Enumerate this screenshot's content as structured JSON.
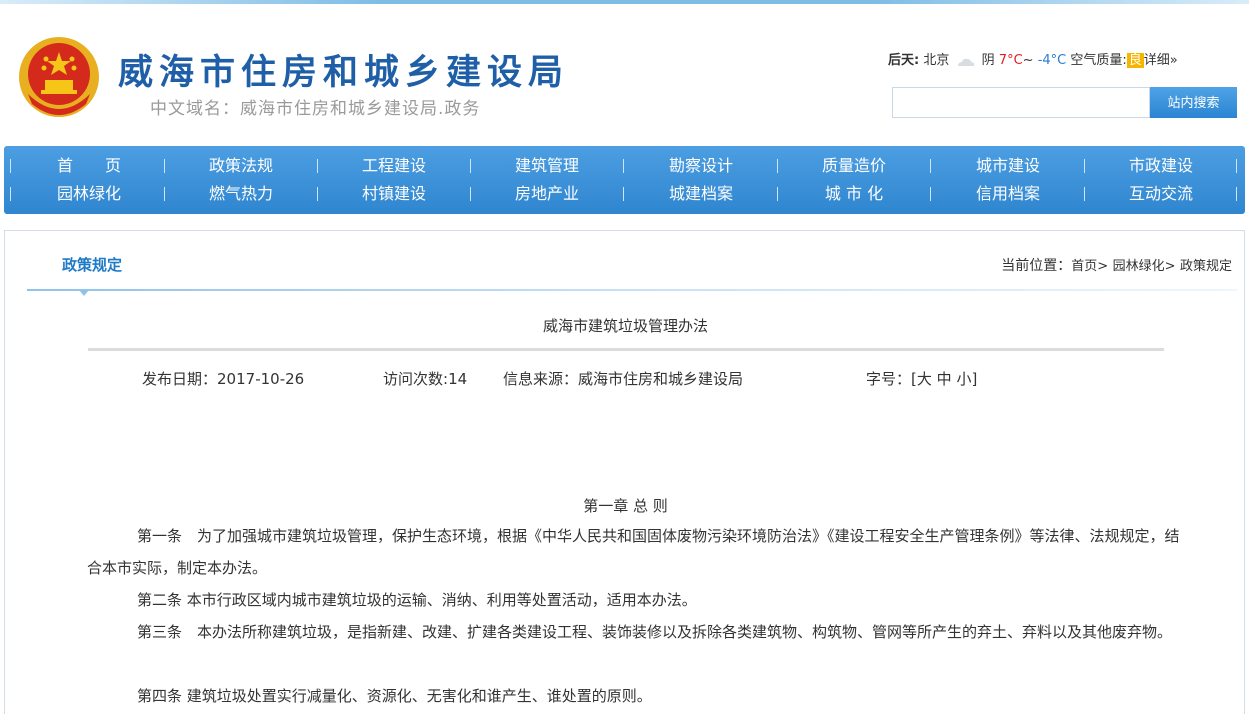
{
  "header": {
    "site_title": "威海市住房和城乡建设局",
    "site_domain": "中文域名：威海市住房和城乡建设局.政务",
    "emblem_icon": "national-emblem-icon"
  },
  "weather": {
    "day_label": "后天:",
    "city": "北京",
    "icon": "cloud-icon",
    "condition": "阴",
    "high": "7°C",
    "separator": "~",
    "low": "-4°C",
    "aqi_label": "空气质量:",
    "aqi_value": "良",
    "details_link": "详细»"
  },
  "search": {
    "placeholder": "",
    "button_label": "站内搜索"
  },
  "nav": {
    "row1": [
      "首　　页",
      "政策法规",
      "工程建设",
      "建筑管理",
      "勘察设计",
      "质量造价",
      "城市建设",
      "市政建设"
    ],
    "row2": [
      "园林绿化",
      "燃气热力",
      "村镇建设",
      "房地产业",
      "城建档案",
      "城 市 化",
      "信用档案",
      "互动交流"
    ]
  },
  "section": {
    "title": "政策规定",
    "breadcrumb_label": "当前位置：",
    "breadcrumb_home": "首页",
    "breadcrumb_sep": ">",
    "breadcrumb_level1": "园林绿化",
    "breadcrumb_level2": "政策规定"
  },
  "article": {
    "title": "威海市建筑垃圾管理办法",
    "publish_label": "发布日期：",
    "publish_date": "2017-10-26",
    "visits_label": "访问次数:",
    "visits": "14",
    "source_label": "信息来源：",
    "source": "威海市住房和城乡建设局",
    "fontsize_label": "字号：",
    "fontsize_open": "[",
    "fontsize_large": "大",
    "fontsize_medium": "中",
    "fontsize_small": "小",
    "fontsize_close": "]",
    "chapter": "第一章 总 则",
    "paragraphs": [
      "第一条　为了加强城市建筑垃圾管理，保护生态环境，根据《中华人民共和国固体废物污染环境防治法》《建设工程安全生产管理条例》等法律、法规规定，结合本市实际，制定本办法。",
      "第二条 本市行政区域内城市建筑垃圾的运输、消纳、利用等处置活动，适用本办法。",
      "第三条　本办法所称建筑垃圾，是指新建、改建、扩建各类建设工程、装饰装修以及拆除各类建筑物、构筑物、管网等所产生的弃土、弃料以及其他废弃物。",
      "第四条 建筑垃圾处置实行减量化、资源化、无害化和谁产生、谁处置的原则。"
    ]
  },
  "colors": {
    "nav_bg": "#3a8fd8",
    "title_blue": "#1f5fa8",
    "section_blue": "#1f7bc6",
    "temp_high": "#e02020",
    "temp_low": "#2a7bd1",
    "aqi_bg": "#f7b500"
  }
}
